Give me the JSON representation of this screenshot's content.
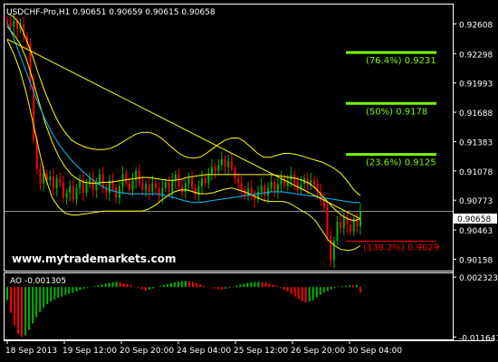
{
  "window": {
    "symbol_header": "USDCHF-Pro,H1  0.90651 0.90659 0.90615 0.90658",
    "watermark": "www.mytrademarkets.com"
  },
  "colors": {
    "background": "#000000",
    "frame": "#ffffff",
    "bull_candle": "#00b400",
    "bear_candle": "#ff0000",
    "bollinger": "#ffff00",
    "trendline": "#ffff00",
    "ma": "#00bfff",
    "fib_line": "#7cfc00",
    "fib_text": "#7cfc00",
    "fib_ext": "#ff0000",
    "price_line": "#8c8c8c",
    "ao_up": "#00b400",
    "ao_down": "#ff0000",
    "text": "#ffffff"
  },
  "chart_data": [
    {
      "type": "candlestick",
      "title": "USDCHF-Pro,H1",
      "ohlc_last": {
        "open": 0.90651,
        "high": 0.90659,
        "low": 0.90615,
        "close": 0.90658
      },
      "ylim": [
        0.9005,
        0.928
      ],
      "y_ticks": [
        "0.92608",
        "0.92298",
        "0.91993",
        "0.91688",
        "0.91383",
        "0.91078",
        "0.90773",
        "0.90463",
        "0.90158"
      ],
      "current_price": "0.90658",
      "x_ticks": [
        "18 Sep 2013",
        "19 Sep 12:00",
        "20 Sep 20:00",
        "24 Sep 04:00",
        "25 Sep 12:00",
        "26 Sep 20:00",
        "30 Sep 04:00"
      ],
      "closes": [
        0.9262,
        0.9258,
        0.9264,
        0.9255,
        0.926,
        0.9248,
        0.924,
        0.92,
        0.914,
        0.911,
        0.9095,
        0.9105,
        0.9098,
        0.9102,
        0.909,
        0.91,
        0.9095,
        0.908,
        0.9085,
        0.9092,
        0.9078,
        0.909,
        0.9098,
        0.9085,
        0.9095,
        0.91,
        0.9088,
        0.9096,
        0.9104,
        0.909,
        0.9085,
        0.9098,
        0.909,
        0.908,
        0.9092,
        0.9105,
        0.9095,
        0.9088,
        0.9098,
        0.9108,
        0.9095,
        0.9088,
        0.9094,
        0.9086,
        0.9095,
        0.909,
        0.9082,
        0.909,
        0.9096,
        0.9086,
        0.9098,
        0.9104,
        0.9092,
        0.9086,
        0.9095,
        0.91,
        0.909,
        0.9083,
        0.9092,
        0.91,
        0.9095,
        0.9105,
        0.9112,
        0.9108,
        0.9114,
        0.912,
        0.9112,
        0.9118,
        0.911,
        0.91,
        0.9095,
        0.9088,
        0.9082,
        0.909,
        0.9084,
        0.9078,
        0.9086,
        0.9092,
        0.9082,
        0.909,
        0.9096,
        0.9086,
        0.9094,
        0.91,
        0.9092,
        0.9098,
        0.9104,
        0.9096,
        0.9088,
        0.9094,
        0.91,
        0.9092,
        0.9098,
        0.9094,
        0.9086,
        0.908,
        0.907,
        0.904,
        0.9015,
        0.9035,
        0.9055,
        0.9048,
        0.906,
        0.9052,
        0.9045,
        0.9058,
        0.905,
        0.9066
      ],
      "bollinger_upper": [
        0.9272,
        0.9268,
        0.926,
        0.9244,
        0.9226,
        0.9206,
        0.9188,
        0.9172,
        0.9158,
        0.9148,
        0.914,
        0.9136,
        0.9133,
        0.9131,
        0.913,
        0.913,
        0.9131,
        0.9134,
        0.9138,
        0.9142,
        0.9146,
        0.9148,
        0.9148,
        0.9146,
        0.9142,
        0.9136,
        0.913,
        0.9125,
        0.9122,
        0.9121,
        0.9122,
        0.9126,
        0.9131,
        0.9136,
        0.914,
        0.9142,
        0.9142,
        0.9138,
        0.9132,
        0.9126,
        0.9122,
        0.9122,
        0.9124,
        0.9126,
        0.9126,
        0.9125,
        0.9123,
        0.9121,
        0.9119,
        0.9117,
        0.9114,
        0.911,
        0.9105,
        0.9097,
        0.9088,
        0.9082
      ],
      "bollinger_middle": [
        0.9258,
        0.925,
        0.924,
        0.9224,
        0.9202,
        0.9178,
        0.9156,
        0.9138,
        0.9123,
        0.9112,
        0.9104,
        0.9099,
        0.9096,
        0.9095,
        0.9095,
        0.9096,
        0.9096,
        0.9097,
        0.9098,
        0.9099,
        0.91,
        0.9101,
        0.9101,
        0.91,
        0.9099,
        0.9098,
        0.9098,
        0.9099,
        0.9101,
        0.9102,
        0.9103,
        0.9104,
        0.9104,
        0.9104,
        0.9104,
        0.9104,
        0.9104,
        0.9104,
        0.9104,
        0.9104,
        0.9104,
        0.9104,
        0.9103,
        0.9102,
        0.9101,
        0.91,
        0.9098,
        0.9095,
        0.909,
        0.9082,
        0.9075,
        0.9068,
        0.9062,
        0.9058,
        0.9056,
        0.9058
      ],
      "bollinger_lower": [
        0.9244,
        0.923,
        0.9212,
        0.9188,
        0.9158,
        0.9128,
        0.91,
        0.908,
        0.907,
        0.9064,
        0.9062,
        0.9062,
        0.9063,
        0.9064,
        0.9065,
        0.9066,
        0.9066,
        0.9066,
        0.9066,
        0.9066,
        0.9066,
        0.9066,
        0.9068,
        0.9072,
        0.9077,
        0.9082,
        0.9086,
        0.9088,
        0.9088,
        0.9086,
        0.9084,
        0.9084,
        0.9085,
        0.9087,
        0.9089,
        0.909,
        0.9088,
        0.9086,
        0.9083,
        0.908,
        0.9077,
        0.9076,
        0.9076,
        0.9076,
        0.9074,
        0.907,
        0.9066,
        0.9062,
        0.9056,
        0.9046,
        0.9036,
        0.903,
        0.9026,
        0.9025,
        0.9026,
        0.903
      ],
      "moving_average": [
        0.9262,
        0.9246,
        0.9228,
        0.921,
        0.9192,
        0.9175,
        0.916,
        0.9147,
        0.9136,
        0.9127,
        0.9119,
        0.9112,
        0.9106,
        0.91,
        0.9095,
        0.9091,
        0.9088,
        0.9086,
        0.9085,
        0.9084,
        0.9084,
        0.9084,
        0.9084,
        0.9084,
        0.9083,
        0.9082,
        0.908,
        0.9078,
        0.9076,
        0.9075,
        0.9075,
        0.9076,
        0.9077,
        0.9078,
        0.9079,
        0.908,
        0.9081,
        0.9082,
        0.9083,
        0.9084,
        0.9085,
        0.9086,
        0.9086,
        0.9086,
        0.9085,
        0.9084,
        0.9083,
        0.9082,
        0.9081,
        0.908,
        0.9079,
        0.9078,
        0.9077,
        0.9076,
        0.9075,
        0.9075
      ],
      "trendline": {
        "start": 0.9245,
        "end": 0.9058
      },
      "fibonacci": [
        {
          "label": "(76.4%) 0.9231",
          "price": 0.9231
        },
        {
          "label": "(50%) 0.9178",
          "price": 0.9178
        },
        {
          "label": "(23.6%) 0.9125",
          "price": 0.9125
        }
      ],
      "fibonacci_extension": {
        "label": "(138.2%) 0.9029",
        "price": 0.9029
      }
    },
    {
      "type": "bar",
      "title": "AO -0.001305",
      "indicator": "Awesome Oscillator",
      "ylim": [
        -0.012,
        0.003
      ],
      "y_ticks": [
        "0.002323",
        "-0.011641"
      ],
      "values": [
        -0.003,
        -0.006,
        -0.009,
        -0.011,
        -0.0116,
        -0.0113,
        -0.01,
        -0.0085,
        -0.007,
        -0.0058,
        -0.0048,
        -0.004,
        -0.0034,
        -0.0029,
        -0.0025,
        -0.0022,
        -0.0019,
        -0.0016,
        -0.0013,
        -0.001,
        -0.0007,
        -0.0004,
        -0.0002,
        0.0,
        0.0002,
        0.0004,
        0.0006,
        0.0008,
        0.001,
        0.0011,
        0.0012,
        0.0011,
        0.0009,
        0.0007,
        0.0004,
        0.0001,
        -0.0002,
        -0.0005,
        -0.0008,
        -0.0006,
        -0.0003,
        0.0,
        0.0002,
        0.0005,
        0.0007,
        0.0009,
        0.0011,
        0.0013,
        0.0014,
        0.0015,
        0.0014,
        0.0012,
        0.0009,
        0.0006,
        0.0003,
        0.0001,
        -0.0001,
        -0.0003,
        -0.0005,
        -0.0006,
        -0.0004,
        -0.0002,
        0.0001,
        0.0004,
        0.0006,
        0.0008,
        0.001,
        0.0011,
        0.0012,
        0.0013,
        0.0012,
        0.001,
        0.0008,
        0.0005,
        0.0002,
        -0.0002,
        -0.0006,
        -0.001,
        -0.0016,
        -0.0022,
        -0.0028,
        -0.0033,
        -0.0036,
        -0.0034,
        -0.003,
        -0.0024,
        -0.0018,
        -0.0013,
        -0.0009,
        -0.0005,
        -0.0002,
        0.0001,
        0.0002,
        0.0003,
        0.0004,
        0.0004,
        0.0005,
        -0.0013
      ]
    }
  ]
}
